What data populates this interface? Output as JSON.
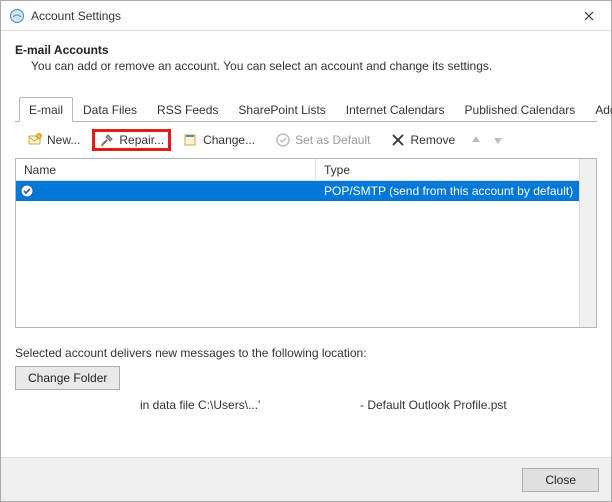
{
  "window": {
    "title": "Account Settings"
  },
  "header": {
    "heading": "E-mail Accounts",
    "subheading": "You can add or remove an account. You can select an account and change its settings."
  },
  "tabs": {
    "email": "E-mail",
    "dataFiles": "Data Files",
    "rss": "RSS Feeds",
    "sharepoint": "SharePoint Lists",
    "internetCal": "Internet Calendars",
    "pubCal": "Published Calendars",
    "addressBooks": "Address Books"
  },
  "toolbar": {
    "new": "New...",
    "repair": "Repair...",
    "change": "Change...",
    "setDefault": "Set as Default",
    "remove": "Remove"
  },
  "list": {
    "headers": {
      "name": "Name",
      "type": "Type"
    },
    "rows": [
      {
        "name": "",
        "type": "POP/SMTP (send from this account by default)"
      }
    ]
  },
  "delivery": {
    "label": "Selected account delivers new messages to the following location:",
    "changeFolder": "Change Folder",
    "pathPrefix": "in data file C:\\Users\\...'",
    "profile": "- Default Outlook Profile.pst"
  },
  "footer": {
    "close": "Close"
  }
}
